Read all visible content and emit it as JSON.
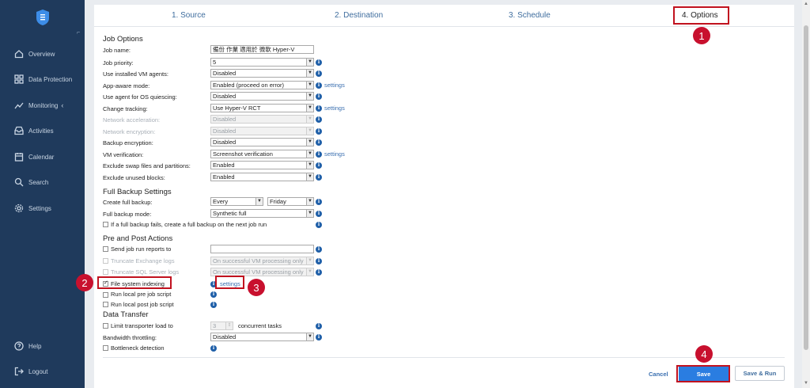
{
  "sidebar": {
    "items": [
      {
        "label": "Overview",
        "icon": "home-icon"
      },
      {
        "label": "Data Protection",
        "icon": "grid-icon"
      },
      {
        "label": "Monitoring",
        "icon": "chart-icon"
      },
      {
        "label": "Activities",
        "icon": "inbox-icon"
      },
      {
        "label": "Calendar",
        "icon": "calendar-icon"
      },
      {
        "label": "Search",
        "icon": "search-icon"
      },
      {
        "label": "Settings",
        "icon": "gear-icon"
      }
    ],
    "help": "Help",
    "logout": "Logout"
  },
  "steps": [
    "1. Source",
    "2. Destination",
    "3. Schedule",
    "4. Options"
  ],
  "job_options": {
    "title": "Job Options",
    "job_name_label": "Job name:",
    "job_name_value": "備份 作業 適用於 微軟 Hyper-V",
    "rows": [
      {
        "label": "Job priority:",
        "value": "5",
        "disabled": false,
        "settings": false
      },
      {
        "label": "Use installed VM agents:",
        "value": "Disabled",
        "disabled": false,
        "settings": false
      },
      {
        "label": "App-aware mode:",
        "value": "Enabled (proceed on error)",
        "disabled": false,
        "settings": true
      },
      {
        "label": "Use agent for OS quiescing:",
        "value": "Disabled",
        "disabled": false,
        "settings": false
      },
      {
        "label": "Change tracking:",
        "value": "Use Hyper-V RCT",
        "disabled": false,
        "settings": true
      },
      {
        "label": "Network acceleration:",
        "value": "Disabled",
        "disabled": true,
        "settings": false
      },
      {
        "label": "Network encryption:",
        "value": "Disabled",
        "disabled": true,
        "settings": false
      },
      {
        "label": "Backup encryption:",
        "value": "Disabled",
        "disabled": false,
        "settings": false
      },
      {
        "label": "VM verification:",
        "value": "Screenshot verification",
        "disabled": false,
        "settings": true
      },
      {
        "label": "Exclude swap files and partitions:",
        "value": "Enabled",
        "disabled": false,
        "settings": false
      },
      {
        "label": "Exclude unused blocks:",
        "value": "Enabled",
        "disabled": false,
        "settings": false
      }
    ],
    "settings_link": "settings"
  },
  "full_backup": {
    "title": "Full Backup Settings",
    "create_label": "Create full backup:",
    "create_every": "Every",
    "create_day": "Friday",
    "mode_label": "Full backup mode:",
    "mode_value": "Synthetic full",
    "fail_checkbox": "If a full backup fails, create a full backup on the next job run"
  },
  "pre_post": {
    "title": "Pre and Post Actions",
    "send_reports": "Send job run reports to",
    "truncate_exchange": "Truncate Exchange logs",
    "truncate_exchange_value": "On successful VM processing only",
    "truncate_sql": "Truncate SQL Server logs",
    "truncate_sql_value": "On successful VM processing only",
    "file_indexing": "File system indexing",
    "settings_link": "settings",
    "run_pre": "Run local pre job script",
    "run_post": "Run local post job script"
  },
  "data_transfer": {
    "title": "Data Transfer",
    "limit_label": "Limit transporter load to",
    "limit_value": "3",
    "limit_suffix": "concurrent tasks",
    "throttling_label": "Bandwidth throttling:",
    "throttling_value": "Disabled",
    "bottleneck": "Bottleneck detection"
  },
  "footer": {
    "cancel": "Cancel",
    "save": "Save",
    "save_run": "Save & Run"
  },
  "badges": [
    "1",
    "2",
    "3",
    "4"
  ],
  "colors": {
    "sidebar": "#1f3a5c",
    "accent": "#2a7de1",
    "highlight": "#c1121f"
  }
}
